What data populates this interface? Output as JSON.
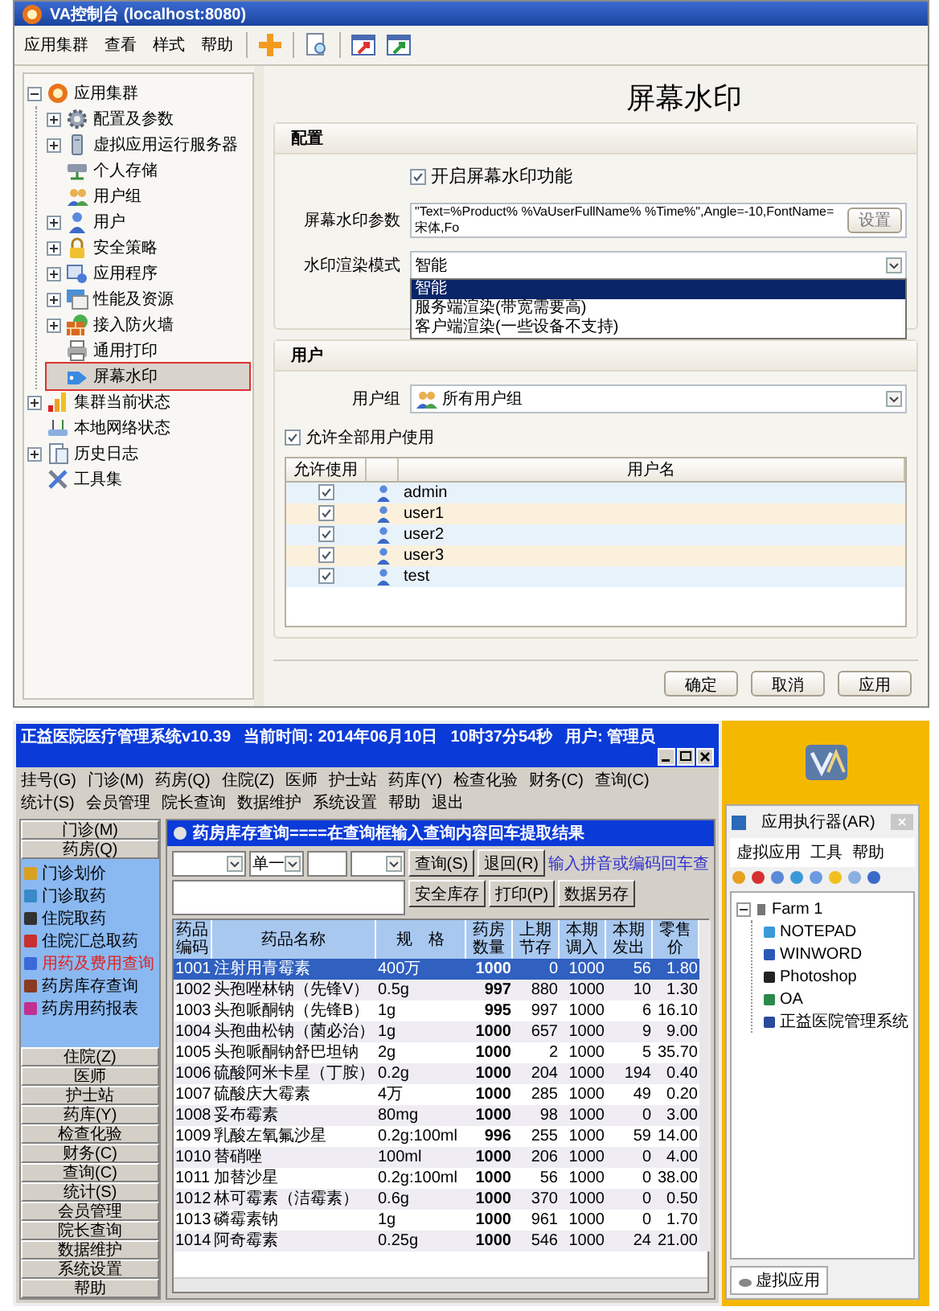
{
  "console": {
    "title": "VA控制台 (localhost:8080)",
    "menu": [
      "应用集群",
      "查看",
      "样式",
      "帮助"
    ],
    "tree": [
      {
        "label": "应用集群",
        "expanded": true,
        "selected": false,
        "children": [
          {
            "label": "配置及参数",
            "expanded": false,
            "selected": false
          },
          {
            "label": "虚拟应用运行服务器",
            "expanded": false,
            "selected": false
          },
          {
            "label": "个人存储",
            "selected": false
          },
          {
            "label": "用户组",
            "selected": false
          },
          {
            "label": "用户",
            "expanded": false,
            "selected": false
          },
          {
            "label": "安全策略",
            "expanded": false,
            "selected": false
          },
          {
            "label": "应用程序",
            "expanded": false,
            "selected": false
          },
          {
            "label": "性能及资源",
            "expanded": false,
            "selected": false
          },
          {
            "label": "接入防火墙",
            "expanded": false,
            "selected": false
          },
          {
            "label": "通用打印",
            "selected": false
          },
          {
            "label": "屏幕水印",
            "selected": true
          }
        ]
      },
      {
        "label": "集群当前状态",
        "expanded": false,
        "selected": false
      },
      {
        "label": "本地网络状态",
        "selected": false
      },
      {
        "label": "历史日志",
        "expanded": false,
        "selected": false
      },
      {
        "label": "工具集",
        "selected": false
      }
    ],
    "page_title": "屏幕水印",
    "config": {
      "heading": "配置",
      "enable": {
        "label": "开启屏幕水印功能",
        "checked": true
      },
      "params": {
        "label": "屏幕水印参数",
        "value": "\"Text=%Product% %VaUserFullName% %Time%\",Angle=-10,FontName=宋体,Fo",
        "button": "设置"
      },
      "mode": {
        "label": "水印渲染模式",
        "value": "智能",
        "expanded": true,
        "options": [
          {
            "label": "智能",
            "selected": true
          },
          {
            "label": "服务端渲染(带宽需要高)",
            "selected": false
          },
          {
            "label": "客户端渲染(一些设备不支持)",
            "selected": false
          }
        ]
      }
    },
    "users": {
      "heading": "用户",
      "group": {
        "label": "用户组",
        "value": "所有用户组"
      },
      "allow_all": {
        "label": "允许全部用户使用",
        "checked": true
      },
      "columns": [
        "允许使用",
        "用户名"
      ],
      "rows": [
        {
          "allowed": true,
          "name": "admin"
        },
        {
          "allowed": true,
          "name": "user1"
        },
        {
          "allowed": true,
          "name": "user2"
        },
        {
          "allowed": true,
          "name": "user3"
        },
        {
          "allowed": true,
          "name": "test"
        }
      ]
    },
    "buttons": [
      "确定",
      "取消",
      "应用"
    ]
  },
  "hospital": {
    "title": "正益医院医疗管理系统v10.39",
    "date": "当前时间: 2014年06月10日",
    "time": "10时37分54秒",
    "user": "用户: 管理员",
    "menu": [
      "挂号(G)",
      "门诊(M)",
      "药房(Q)",
      "住院(Z)",
      "医师",
      "护士站",
      "药库(Y)",
      "检查化验",
      "财务(C)",
      "查询(C)",
      "统计(S)",
      "会员管理",
      "院长查询",
      "数据维护",
      "系统设置",
      "帮助",
      "退出"
    ],
    "sidebar": {
      "groups_top": [
        "门诊(M)",
        "药房(Q)"
      ],
      "items": [
        {
          "label": "门诊划价",
          "selected": false
        },
        {
          "label": "门诊取药",
          "selected": false
        },
        {
          "label": "住院取药",
          "selected": false
        },
        {
          "label": "住院汇总取药",
          "selected": false
        },
        {
          "label": "用药及费用查询",
          "selected": true
        },
        {
          "label": "药房库存查询",
          "selected": false
        },
        {
          "label": "药房用药报表",
          "selected": false
        }
      ],
      "groups_bottom": [
        "住院(Z)",
        "医师",
        "护士站",
        "药库(Y)",
        "检查化验",
        "财务(C)",
        "查询(C)",
        "统计(S)",
        "会员管理",
        "院长查询",
        "数据维护",
        "系统设置",
        "帮助"
      ]
    },
    "query": {
      "title": "药房库存查询====在查询框输入查询内容回车提取结果",
      "mode": "单一",
      "buttons_top": [
        "查询(S)",
        "退回(R)"
      ],
      "hint": "输入拼音或编码回车查",
      "buttons_bottom": [
        "安全库存",
        "打印(P)",
        "数据另存"
      ],
      "columns": [
        "药品编码",
        "药品名称",
        "规　格",
        "药房数量",
        "上期节存",
        "本期调入",
        "本期发出",
        "零售价"
      ],
      "rows": [
        {
          "selected": true,
          "cells": [
            "1001",
            "注射用青霉素",
            "400万",
            "1000",
            "0",
            "1000",
            "56",
            "1.80"
          ]
        },
        {
          "selected": false,
          "cells": [
            "1002",
            "头孢唑林钠（先锋V）",
            "0.5g",
            "997",
            "880",
            "1000",
            "10",
            "1.30"
          ]
        },
        {
          "selected": false,
          "cells": [
            "1003",
            "头孢哌酮钠（先锋B）",
            "1g",
            "995",
            "997",
            "1000",
            "6",
            "16.10"
          ]
        },
        {
          "selected": false,
          "cells": [
            "1004",
            "头孢曲松钠（菌必治）",
            "1g",
            "1000",
            "657",
            "1000",
            "9",
            "9.00"
          ]
        },
        {
          "selected": false,
          "cells": [
            "1005",
            "头孢哌酮钠舒巴坦钠",
            "2g",
            "1000",
            "2",
            "1000",
            "5",
            "35.70"
          ]
        },
        {
          "selected": false,
          "cells": [
            "1006",
            "硫酸阿米卡星（丁胺）",
            "0.2g",
            "1000",
            "204",
            "1000",
            "194",
            "0.40"
          ]
        },
        {
          "selected": false,
          "cells": [
            "1007",
            "硫酸庆大霉素",
            "4万",
            "1000",
            "285",
            "1000",
            "49",
            "0.20"
          ]
        },
        {
          "selected": false,
          "cells": [
            "1008",
            "妥布霉素",
            "80mg",
            "1000",
            "98",
            "1000",
            "0",
            "3.00"
          ]
        },
        {
          "selected": false,
          "cells": [
            "1009",
            "乳酸左氧氟沙星",
            "0.2g:100ml",
            "996",
            "255",
            "1000",
            "59",
            "14.00"
          ]
        },
        {
          "selected": false,
          "cells": [
            "1010",
            "替硝唑",
            "100ml",
            "1000",
            "206",
            "1000",
            "0",
            "4.00"
          ]
        },
        {
          "selected": false,
          "cells": [
            "1011",
            "加替沙星",
            "0.2g:100ml",
            "1000",
            "56",
            "1000",
            "0",
            "38.00"
          ]
        },
        {
          "selected": false,
          "cells": [
            "1012",
            "林可霉素（洁霉素）",
            "0.6g",
            "1000",
            "370",
            "1000",
            "0",
            "0.50"
          ]
        },
        {
          "selected": false,
          "cells": [
            "1013",
            "磷霉素钠",
            "1g",
            "1000",
            "961",
            "1000",
            "0",
            "1.70"
          ]
        },
        {
          "selected": false,
          "cells": [
            "1014",
            "阿奇霉素",
            "0.25g",
            "1000",
            "546",
            "1000",
            "24",
            "21.00"
          ]
        }
      ]
    }
  },
  "runner": {
    "title": "应用执行器(AR)",
    "menu": [
      "虚拟应用",
      "工具",
      "帮助"
    ],
    "tree": {
      "label": "Farm 1",
      "expanded": true,
      "children": [
        "NOTEPAD",
        "WINWORD",
        "Photoshop",
        "OA",
        "正益医院管理系统"
      ]
    },
    "tab": "虚拟应用"
  }
}
